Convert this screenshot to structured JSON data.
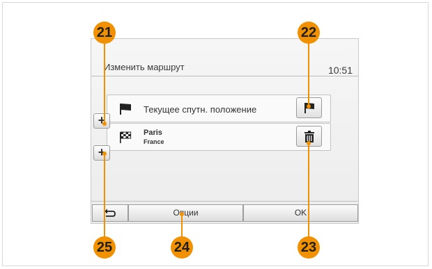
{
  "header": {
    "title": "Изменить маршрут",
    "time": "10:51"
  },
  "route": {
    "items": [
      {
        "label": "Текущее спутн. положение",
        "icon": "flag-icon",
        "action_icon": "flag-icon"
      },
      {
        "label": "Paris",
        "sublabel": "France",
        "icon": "checkered-flag-icon",
        "action_icon": "trash-icon"
      }
    ],
    "add_label": "+"
  },
  "footer": {
    "back_icon": "back-arrow-icon",
    "options_label": "Опции",
    "ok_label": "OK"
  },
  "callouts": {
    "c21": "21",
    "c22": "22",
    "c23": "23",
    "c24": "24",
    "c25": "25"
  },
  "colors": {
    "callout": "#f29100",
    "screen_bg": "#f0f0f0"
  }
}
